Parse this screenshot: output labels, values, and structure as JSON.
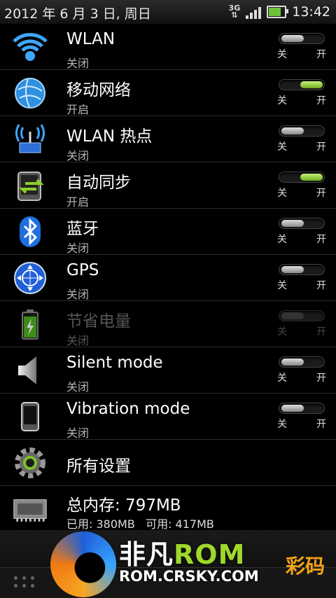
{
  "status_bar": {
    "date": "2012 年 6 月 3 日, 周日",
    "network": "3G",
    "time": "13:42"
  },
  "toggle_labels": {
    "off": "关",
    "on": "开"
  },
  "rows": [
    {
      "title": "WLAN",
      "state": "关闭",
      "on": false,
      "icon": "wifi-icon"
    },
    {
      "title": "移动网络",
      "state": "开启",
      "on": true,
      "icon": "mobile-network-icon"
    },
    {
      "title": "WLAN 热点",
      "state": "关闭",
      "on": false,
      "icon": "hotspot-icon"
    },
    {
      "title": "自动同步",
      "state": "开启",
      "on": true,
      "icon": "sync-icon"
    },
    {
      "title": "蓝牙",
      "state": "关闭",
      "on": false,
      "icon": "bluetooth-icon"
    },
    {
      "title": "GPS",
      "state": "关闭",
      "on": false,
      "icon": "gps-icon"
    },
    {
      "title": "节省电量",
      "state": "关闭",
      "on": false,
      "icon": "battery-saver-icon",
      "disabled": true
    },
    {
      "title": "Silent mode",
      "state": "关闭",
      "on": false,
      "icon": "speaker-icon"
    },
    {
      "title": "Vibration mode",
      "state": "关闭",
      "on": false,
      "icon": "vibration-icon"
    }
  ],
  "all_settings": {
    "label": "所有设置",
    "icon": "gear-icon"
  },
  "storage": {
    "title": "总内存: 797MB",
    "used": "已用: 380MB",
    "free": "可用: 417MB",
    "icon": "memory-chip-icon"
  },
  "watermark": {
    "brand_prefix": "非凡",
    "brand_suffix": "ROM",
    "url": "ROM.CRSKY.COM",
    "badge": "彩码"
  },
  "colors": {
    "toggle_on": "#8ccf2a",
    "background": "#000000"
  }
}
